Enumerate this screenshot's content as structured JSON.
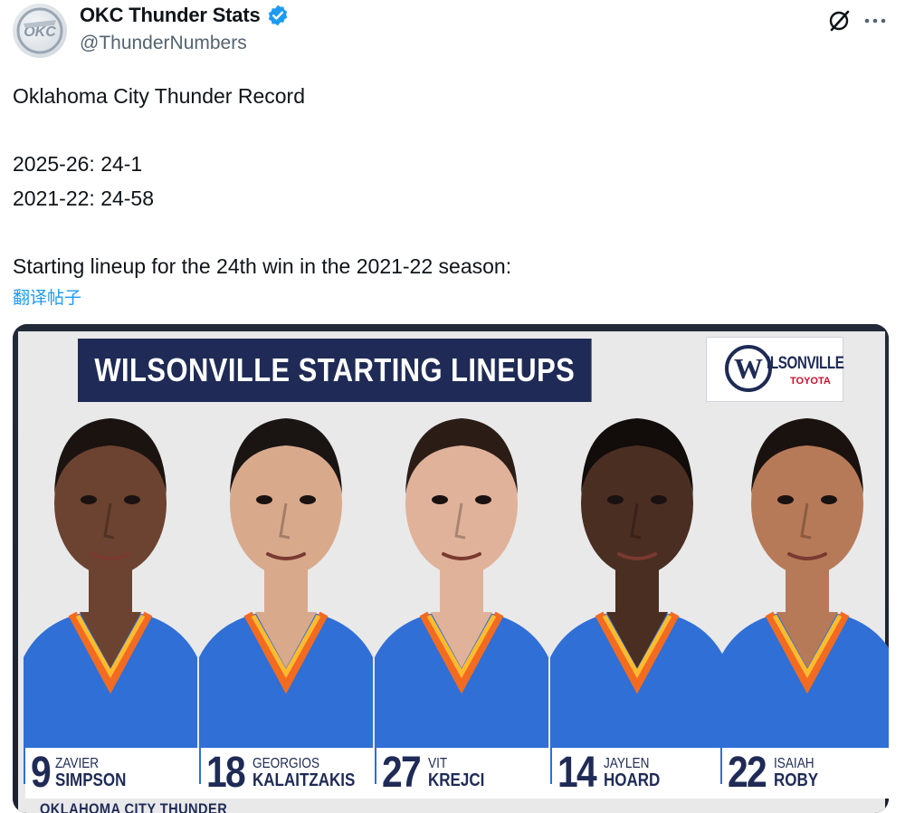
{
  "post": {
    "display_name": "OKC Thunder Stats",
    "handle": "@ThunderNumbers",
    "verified": true,
    "icons": {
      "avatar": "thunder-logo-avatar",
      "verified": "verified-badge-icon",
      "grok": "grok-icon",
      "more": "more-icon"
    },
    "lines": [
      "Oklahoma City Thunder Record",
      "",
      "2025-26: 24-1",
      "2021-22: 24-58",
      "",
      "Starting lineup for the 24th win in the 2021-22 season:"
    ],
    "translate_label": "翻译帖子"
  },
  "media": {
    "banner_title": "WILSONVILLE STARTING LINEUPS",
    "sponsor_logo_letter": "W",
    "sponsor_name": "ILSONVILLE",
    "sponsor_sub": "TOYOTA",
    "team_footer": "OKLAHOMA CITY THUNDER",
    "players": [
      {
        "number": "9",
        "first": "ZAVIER",
        "last": "SIMPSON",
        "skin": "#6b4330",
        "hair": "#1b1310"
      },
      {
        "number": "18",
        "first": "GEORGIOS",
        "last": "KALAITZAKIS",
        "skin": "#d9a98c",
        "hair": "#1a1412"
      },
      {
        "number": "27",
        "first": "VIT",
        "last": "KREJCI",
        "skin": "#e0b29a",
        "hair": "#2b1d16"
      },
      {
        "number": "14",
        "first": "JAYLEN",
        "last": "HOARD",
        "skin": "#4b2e22",
        "hair": "#120c0a"
      },
      {
        "number": "22",
        "first": "ISAIAH",
        "last": "ROBY",
        "skin": "#b77a58",
        "hair": "#1a120e"
      }
    ],
    "colors": {
      "navy": "#1f2b56",
      "jersey_blue": "#2f6fd6",
      "jersey_orange": "#f26b21",
      "jersey_yellow": "#fdbb30"
    }
  }
}
